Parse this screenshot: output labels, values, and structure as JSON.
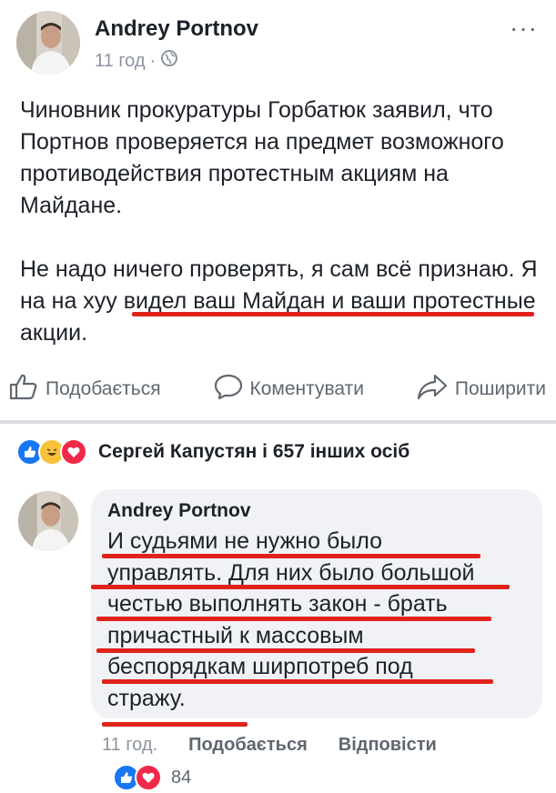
{
  "post": {
    "author": "Andrey Portnov",
    "time": "11 год",
    "meta_separator": "·",
    "privacy_icon": "globe-icon",
    "more_icon": "more-icon",
    "paragraph1": "Чиновник прокуратуры Горбатюк заявил, что Портнов проверяется на предмет возможного противодействия протестным акциям на Майдане.",
    "paragraph2_start": "Не надо ничего проверять, я сам всё признаю. ",
    "paragraph2_highlight": "Я на на хуу видел ваш Майдан и",
    "paragraph2_end": " ваши протестные акции."
  },
  "actions": {
    "like": "Подобається",
    "comment": "Коментувати",
    "share": "Поширити"
  },
  "reactions": {
    "summary": "Сергей Капустян і 657 інших осіб",
    "icons": [
      "like-icon",
      "haha-icon",
      "love-icon"
    ]
  },
  "comment": {
    "author": "Andrey Portnov",
    "lines": [
      "И судьями не нужно было",
      "управлять. Для них было большой",
      "честью выполнять закон - брать",
      "причастный к массовым",
      "беспорядкам ширпотреб под",
      "стражу."
    ],
    "time": "11 год.",
    "like": "Подобається",
    "reply": "Відповісти",
    "reaction_count": "84"
  },
  "colors": {
    "accent_blue": "#1877f2",
    "underline_red": "#e0231a",
    "text": "#1d2129",
    "muted": "#8d949e",
    "bubble": "#f0f2f5"
  }
}
